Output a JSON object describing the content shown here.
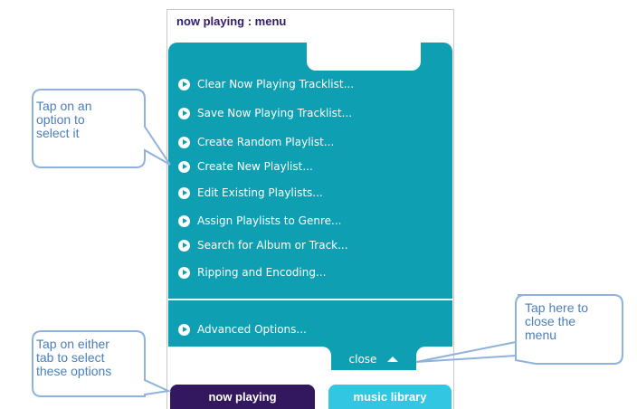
{
  "window": {
    "title": "now playing : menu"
  },
  "menu": {
    "items": [
      {
        "label": "Clear Now Playing Tracklist..."
      },
      {
        "label": "Save Now Playing Tracklist..."
      },
      {
        "label": "Create Random Playlist..."
      },
      {
        "label": "Create New Playlist..."
      },
      {
        "label": "Edit Existing Playlists..."
      },
      {
        "label": "Assign Playlists to Genre..."
      },
      {
        "label": "Search for Album or Track..."
      },
      {
        "label": "Ripping and Encoding..."
      }
    ],
    "advanced": {
      "label": "Advanced Options..."
    },
    "close_label": "close"
  },
  "tabs": [
    {
      "label": "now playing"
    },
    {
      "label": "music library"
    }
  ],
  "callouts": {
    "select_option": "Tap on an\noption to\nselect it",
    "close_menu": "Tap here to\nclose the\nmenu",
    "tabs": "Tap on either\ntab to select\nthese options"
  },
  "colors": {
    "menu_bg": "#0f9fb2",
    "title": "#2f1d6b",
    "tab_now_playing": "#33175f",
    "tab_music_library": "#33c6e2",
    "callout": "#4b7fbc"
  },
  "icons": {
    "bullet": "play-bullet-icon",
    "close": "triangle-up-icon"
  }
}
